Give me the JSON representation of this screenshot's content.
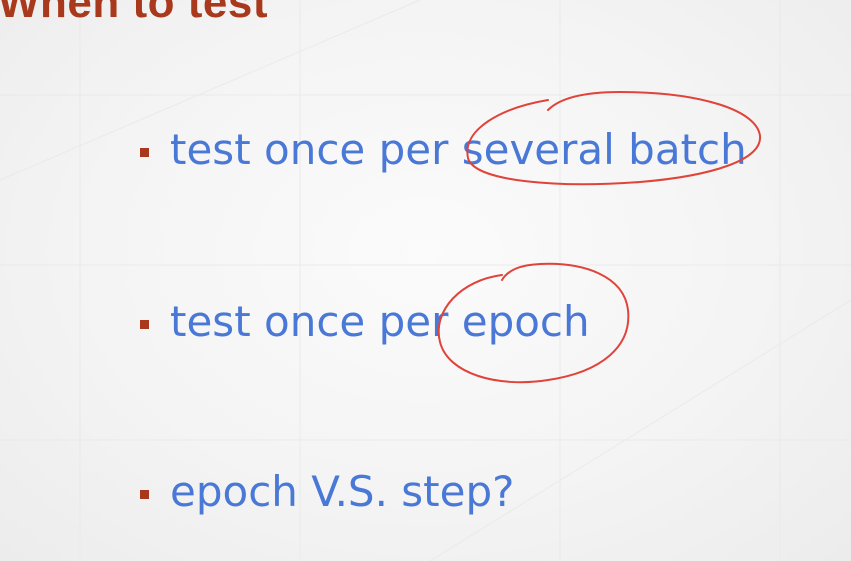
{
  "slide": {
    "title": "When to test",
    "bullets": [
      "test once per several batch",
      "test once per epoch",
      "epoch V.S. step?"
    ],
    "colors": {
      "title": "#a8391c",
      "bullet_text": "#4a78d6",
      "bullet_marker": "#a8391c",
      "annotation_ink": "#e0433a",
      "background": "#f3f3f3"
    }
  },
  "annotations": [
    {
      "name": "circle-around-several-batch",
      "encircles": "several batch"
    },
    {
      "name": "circle-around-epoch",
      "encircles": "epoch"
    }
  ]
}
